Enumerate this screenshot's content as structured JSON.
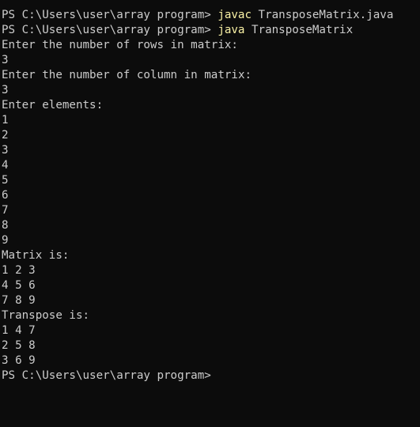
{
  "terminal": {
    "colors": {
      "background": "#0c0c0c",
      "foreground": "#cccccc",
      "command_highlight": "#f9f1a5"
    },
    "commands": [
      {
        "prompt": "PS C:\\Users\\user\\array program>",
        "command": "javac",
        "argument": "TransposeMatrix.java"
      },
      {
        "prompt": "PS C:\\Users\\user\\array program>",
        "command": "java",
        "argument": "TransposeMatrix"
      }
    ],
    "output": [
      "Enter the number of rows in matrix:",
      "3",
      "Enter the number of column in matrix:",
      "3",
      "Enter elements:",
      "1",
      "2",
      "3",
      "4",
      "5",
      "6",
      "7",
      "8",
      "9",
      "Matrix is:",
      "1 2 3",
      "4 5 6",
      "7 8 9",
      "Transpose is:",
      "1 4 7",
      "2 5 8",
      "3 6 9"
    ],
    "final_prompt": "PS C:\\Users\\user\\array program>"
  }
}
